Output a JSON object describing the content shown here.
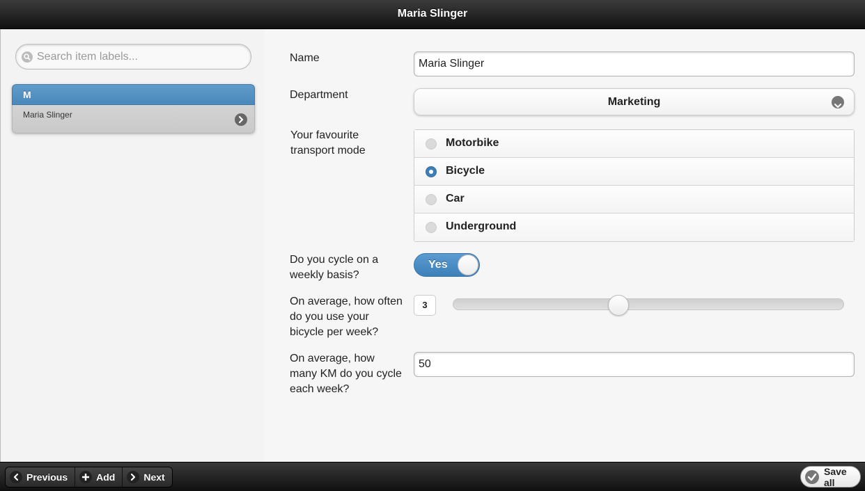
{
  "header": {
    "title": "Maria Slinger"
  },
  "sidebar": {
    "search_placeholder": "Search item labels...",
    "divider": "M",
    "items": [
      {
        "label": "Maria Slinger"
      }
    ]
  },
  "form": {
    "name": {
      "label": "Name",
      "value": "Maria Slinger"
    },
    "department": {
      "label": "Department",
      "value": "Marketing"
    },
    "transport": {
      "label_line1": "Your favourite",
      "label_line2": "transport mode",
      "options": [
        "Motorbike",
        "Bicycle",
        "Car",
        "Underground"
      ],
      "selected": "Bicycle"
    },
    "cycle_weekly": {
      "label_line1": "Do you cycle on a",
      "label_line2": "weekly basis?",
      "value": "Yes"
    },
    "frequency": {
      "label_line1": "On average, how often",
      "label_line2": "do you use your",
      "label_line3": "bicycle per week?",
      "value": "3",
      "fraction": 0.42
    },
    "km": {
      "label_line1": "On average, how",
      "label_line2": "many KM do you cycle",
      "label_line3": "each week?",
      "value": "50"
    }
  },
  "footer": {
    "previous": "Previous",
    "add": "Add",
    "next": "Next",
    "save_all": "Save all"
  }
}
